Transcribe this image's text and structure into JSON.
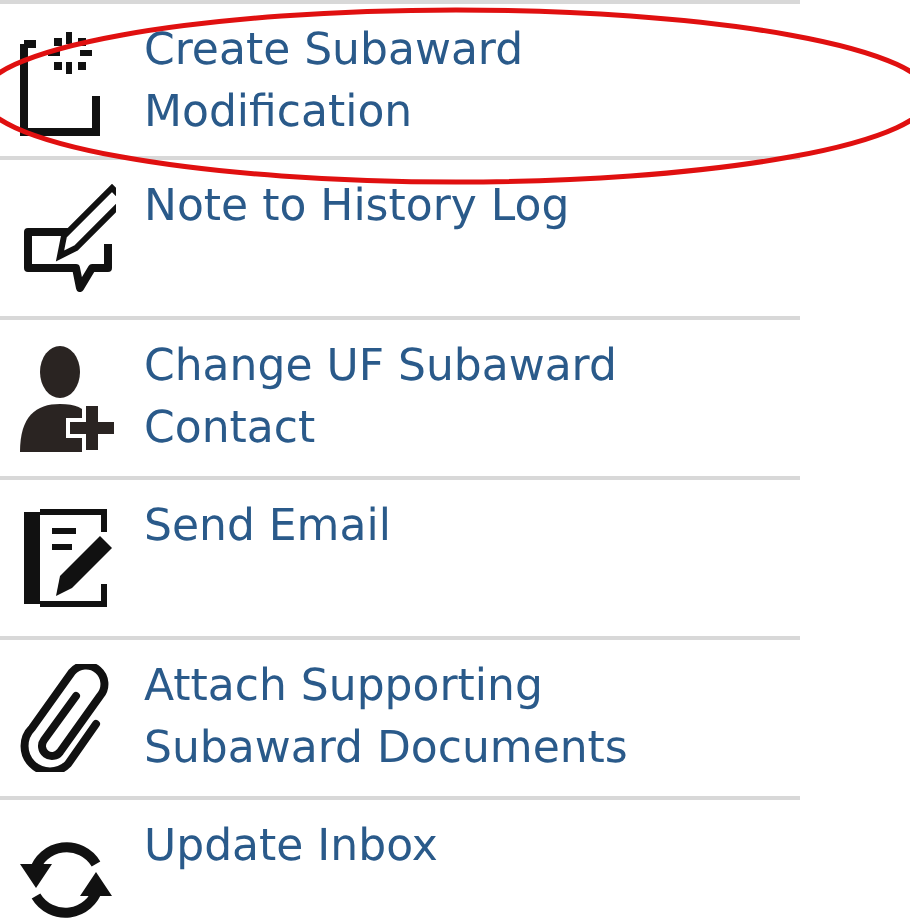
{
  "actions": [
    {
      "label": "Create Subaward Modification",
      "highlighted": true
    },
    {
      "label": "Note to History Log",
      "highlighted": false
    },
    {
      "label": "Change UF Subaward Contact",
      "highlighted": false
    },
    {
      "label": "Send Email",
      "highlighted": false
    },
    {
      "label": "Attach Supporting Subaward Documents",
      "highlighted": false
    },
    {
      "label": "Update Inbox",
      "highlighted": false
    }
  ]
}
